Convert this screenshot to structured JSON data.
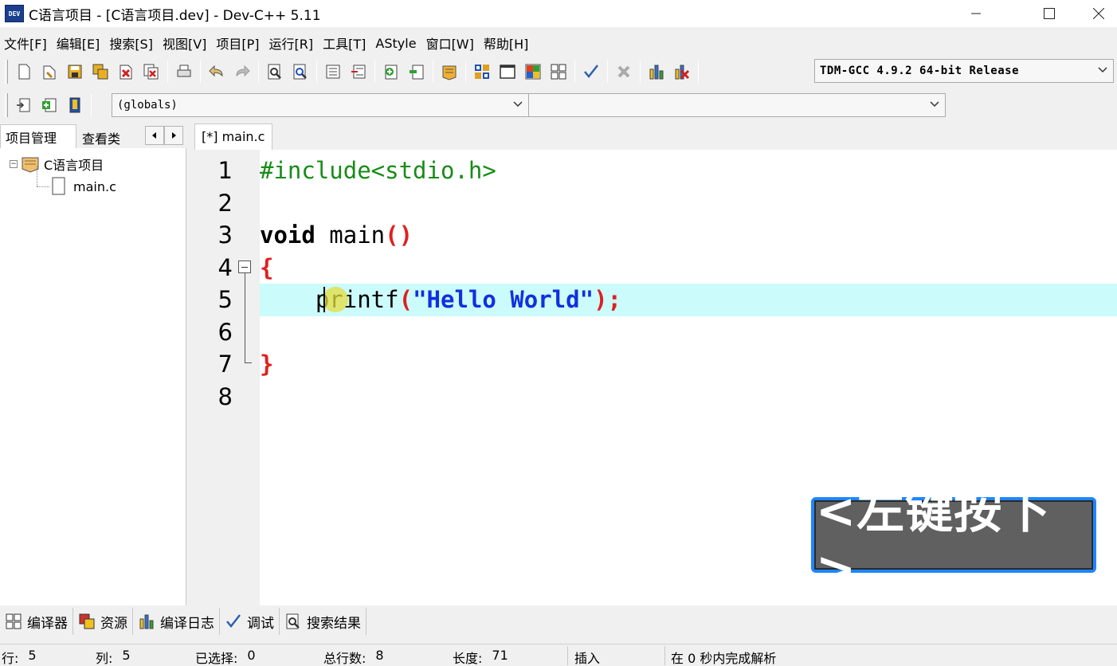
{
  "window": {
    "icon_text": "DEV",
    "title": "C语言项目 - [C语言项目.dev] - Dev-C++ 5.11"
  },
  "menu": [
    "文件[F]",
    "编辑[E]",
    "搜索[S]",
    "视图[V]",
    "项目[P]",
    "运行[R]",
    "工具[T]",
    "AStyle",
    "窗口[W]",
    "帮助[H]"
  ],
  "toolbar": {
    "compiler": "TDM-GCC 4.9.2 64-bit Release",
    "globals": "(globals)",
    "function": ""
  },
  "left_panel": {
    "tabs": [
      "项目管理",
      "查看类"
    ],
    "project_name": "C语言项目",
    "files": [
      "main.c"
    ]
  },
  "editor": {
    "tab_label": "[*] main.c",
    "line_numbers": [
      "1",
      "2",
      "3",
      "4",
      "5",
      "6",
      "7",
      "8"
    ],
    "lines": {
      "l1": "#include<stdio.h>",
      "l3_kw": "void",
      "l3_fn": " main",
      "l3_p": "()",
      "l4": "{",
      "l5_indent": "    ",
      "l5_fn": "printf",
      "l5_p1": "(",
      "l5_str": "\"Hello World\"",
      "l5_p2": ");",
      "l7": "}"
    },
    "current_line": 5
  },
  "overlay": {
    "text": "<左键按下>"
  },
  "bottom_tabs": [
    "编译器",
    "资源",
    "编译日志",
    "调试",
    "搜索结果"
  ],
  "status": {
    "row_label": "行:",
    "row": "5",
    "col_label": "列:",
    "col": "5",
    "sel_label": "已选择:",
    "sel": "0",
    "total_label": "总行数:",
    "total": "8",
    "len_label": "长度:",
    "len": "71",
    "mode": "插入",
    "parse": "在 0 秒内完成解析"
  }
}
